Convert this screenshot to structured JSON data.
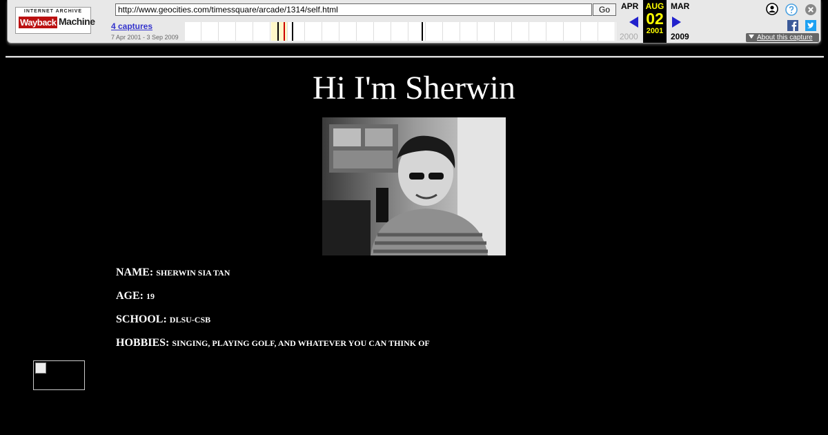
{
  "toolbar": {
    "logo_top": "INTERNET ARCHIVE",
    "logo_wayback": "Wayback",
    "logo_machine": "Machine",
    "url": "http://www.geocities.com/timessquare/arcade/1314/self.html",
    "go_label": "Go",
    "captures_label": "4 captures",
    "date_range": "7 Apr 2001 - 3 Sep 2009",
    "prev_month": "APR",
    "current_month": "AUG",
    "next_month": "MAR",
    "current_day": "02",
    "prev_year": "2000",
    "current_year": "2001",
    "next_year": "2009",
    "about_label": "About this capture",
    "accent_color": "#ffff00"
  },
  "page": {
    "title": "Hi I'm Sherwin",
    "info": [
      {
        "label": "NAME:",
        "value": "SHERWIN SIA TAN"
      },
      {
        "label": "AGE:",
        "value": "19"
      },
      {
        "label": "SCHOOL:",
        "value": "DLSU-CSB"
      },
      {
        "label": "HOBBIES:",
        "value": "SINGING, PLAYING GOLF, AND WHATEVER YOU CAN THINK OF"
      }
    ]
  }
}
